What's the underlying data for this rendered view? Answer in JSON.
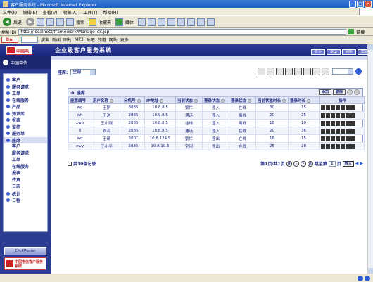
{
  "window": {
    "title": "客户服务系统 - Microsoft Internet Explorer",
    "buttons": [
      "_",
      "□",
      "×"
    ]
  },
  "menubar": [
    "文件(F)",
    "编辑(E)",
    "查看(V)",
    "收藏(A)",
    "工具(T)",
    "帮助(H)"
  ],
  "toolbar": {
    "back_label": "后退",
    "search_label": "搜索",
    "favorites_label": "收藏夹",
    "media_label": "媒体"
  },
  "address": {
    "label": "地址(D)",
    "value": "http://localhost/framework/Manage_qs.jsp",
    "links_label": "链接"
  },
  "links": {
    "items": [
      "搜索",
      "新闻",
      "图片",
      "MP3",
      "贴吧",
      "知道",
      "网站",
      "更多"
    ]
  },
  "app": {
    "title": "企业级客户服务系统",
    "logo_text": "中国电信",
    "header_buttons": [
      "首页",
      "退出",
      "刷新",
      "帮助"
    ]
  },
  "sidebar": {
    "top_label": "中国电信",
    "items": [
      {
        "label": "客户",
        "type": "item"
      },
      {
        "label": "服务请求",
        "type": "item"
      },
      {
        "label": "工单",
        "type": "item"
      },
      {
        "label": "在线服务",
        "type": "item"
      },
      {
        "label": "产品",
        "type": "item"
      },
      {
        "label": "知识库",
        "type": "item"
      },
      {
        "label": "报表",
        "type": "item"
      },
      {
        "label": "监控",
        "type": "item"
      },
      {
        "label": "服务单",
        "type": "item"
      },
      {
        "label": "座席",
        "type": "item",
        "active": true
      }
    ],
    "subitems": [
      "客户",
      "服务请求",
      "工单",
      "在线服务",
      "报表",
      "传真",
      "日志"
    ],
    "bottom_items": [
      "统计",
      "日程"
    ],
    "footer_label": "ClickMaster",
    "footer_logo": "中国电信客户服务系统"
  },
  "filter": {
    "label": "座席:",
    "value": "全部"
  },
  "panel": {
    "title": "座席",
    "buttons": [
      "添加",
      "删除"
    ]
  },
  "table": {
    "columns": [
      "座席编号",
      "用户名称",
      "分机号",
      "IP地址",
      "当前状态",
      "登录状态",
      "登录状态",
      "当前状态时长",
      "登录时长",
      "操作"
    ],
    "rows": [
      [
        "wg",
        "王刚",
        "8885",
        "10.8.8.5",
        "繁忙",
        "登入",
        "在线",
        "30",
        "15"
      ],
      [
        "wh",
        "王浩",
        "2885",
        "10.9.8.5",
        "通话",
        "登入",
        "离线",
        "20",
        "25"
      ],
      [
        "xwg",
        "王小刚",
        "2885",
        "10.8.8.5",
        "挂线",
        "登入",
        "离线",
        "18",
        "10"
      ],
      [
        "ll",
        "刘鸿",
        "2885",
        "10.8.8.5",
        "通话",
        "登入",
        "在线",
        "20",
        "36"
      ],
      [
        "wq",
        "王晴",
        "280T",
        "10.8.124.5",
        "繁忙",
        "登出",
        "在线",
        "18",
        "15"
      ],
      [
        "xwy",
        "王小平",
        "2885",
        "10.8.10.5",
        "空闲",
        "登出",
        "在线",
        "25",
        "28"
      ]
    ]
  },
  "pager": {
    "total": "共10条记录",
    "page_info": "第1页/共1页",
    "goto_label": "跳至第",
    "page_value": "1",
    "page_suffix": "页",
    "go_label": "转入",
    "nav_buttons": [
      "首",
      "上",
      "下",
      "尾"
    ]
  }
}
